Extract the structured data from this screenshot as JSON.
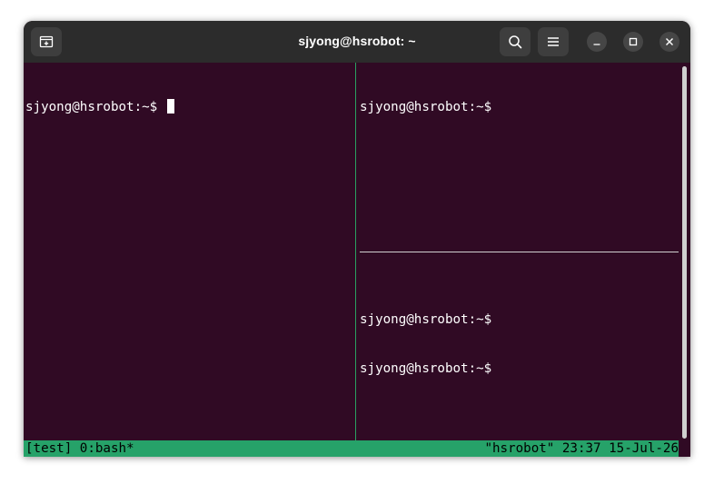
{
  "window": {
    "title": "sjyong@hsrobot: ~"
  },
  "icons": {
    "new_tab": "new-tab-icon",
    "search": "search-icon",
    "menu": "hamburger-menu-icon",
    "minimize": "minimize-icon",
    "maximize": "maximize-icon",
    "close": "close-icon"
  },
  "panes": {
    "left": {
      "lines": [
        "sjyong@hsrobot:~$ "
      ]
    },
    "right_top": {
      "lines": [
        "sjyong@hsrobot:~$"
      ]
    },
    "right_bottom": {
      "lines": [
        "sjyong@hsrobot:~$",
        "sjyong@hsrobot:~$"
      ]
    }
  },
  "statusbar": {
    "left": "[test] 0:bash*",
    "right": "\"hsrobot\" 23:37 15-Jul-26"
  },
  "colors": {
    "terminal_bg": "#300a24",
    "status_bg": "#26a269",
    "titlebar_bg": "#2c2c2c"
  }
}
